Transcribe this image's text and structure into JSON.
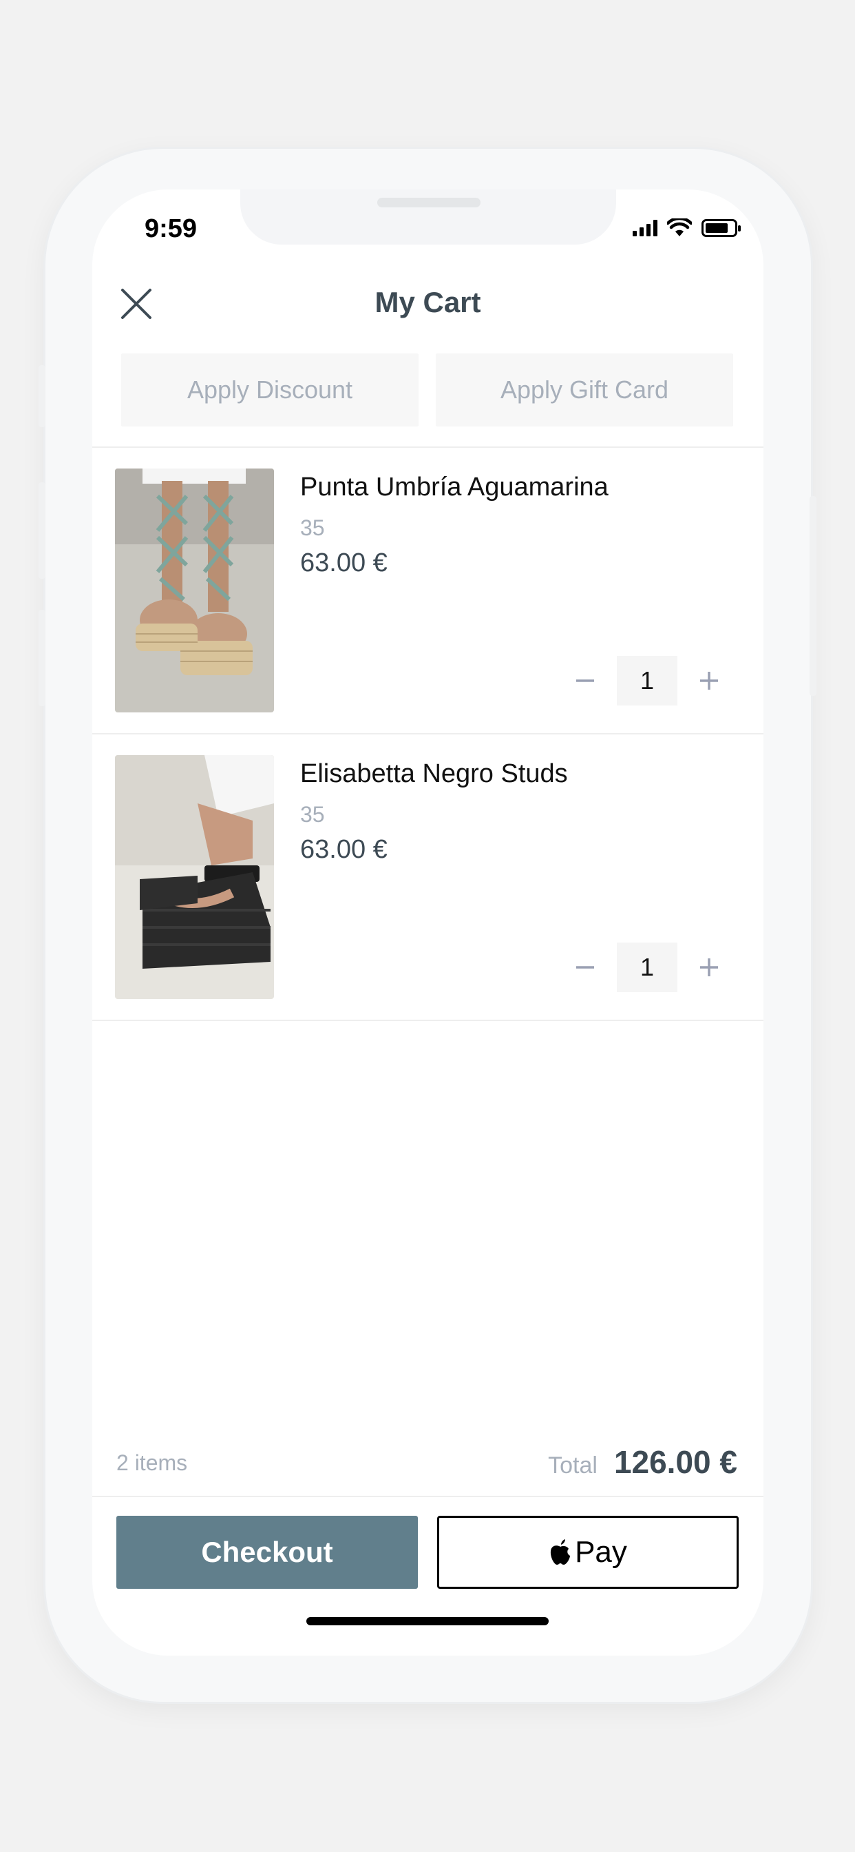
{
  "status_bar": {
    "time": "9:59"
  },
  "header": {
    "title": "My Cart"
  },
  "actions": {
    "discount_label": "Apply Discount",
    "gift_card_label": "Apply Gift Card"
  },
  "items": [
    {
      "name": "Punta Umbría Aguamarina",
      "size": "35",
      "price": "63.00 €",
      "quantity": "1",
      "image_icon": "green-lace-up-espadrille-sandal"
    },
    {
      "name": "Elisabetta Negro Studs",
      "size": "35",
      "price": "63.00 €",
      "quantity": "1",
      "image_icon": "black-platform-espadrille-sandal"
    }
  ],
  "summary": {
    "count": "2 items",
    "total_label": "Total",
    "total_value": "126.00 €"
  },
  "buttons": {
    "checkout": "Checkout",
    "applepay": "Pay"
  },
  "colors": {
    "accent": "#617f8c",
    "muted": "#a7afba",
    "title": "#3d4a54"
  }
}
